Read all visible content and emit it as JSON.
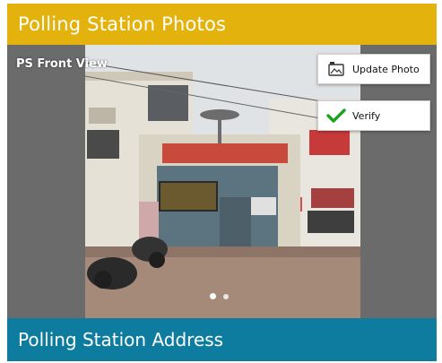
{
  "header": {
    "title": "Polling Station Photos"
  },
  "photo": {
    "label": "PS Front View"
  },
  "actions": {
    "update_photo_label": "Update Photo",
    "verify_label": "Verify"
  },
  "carousel": {
    "total_slides": 2,
    "active_index": 0
  },
  "footer": {
    "title": "Polling Station Address"
  },
  "colors": {
    "header_bg": "#e4b20c",
    "footer_bg": "#0e7c9e",
    "verify_check": "#1aa31a"
  },
  "icons": {
    "update_photo": "camera-photo-icon",
    "verify": "checkmark-icon"
  }
}
